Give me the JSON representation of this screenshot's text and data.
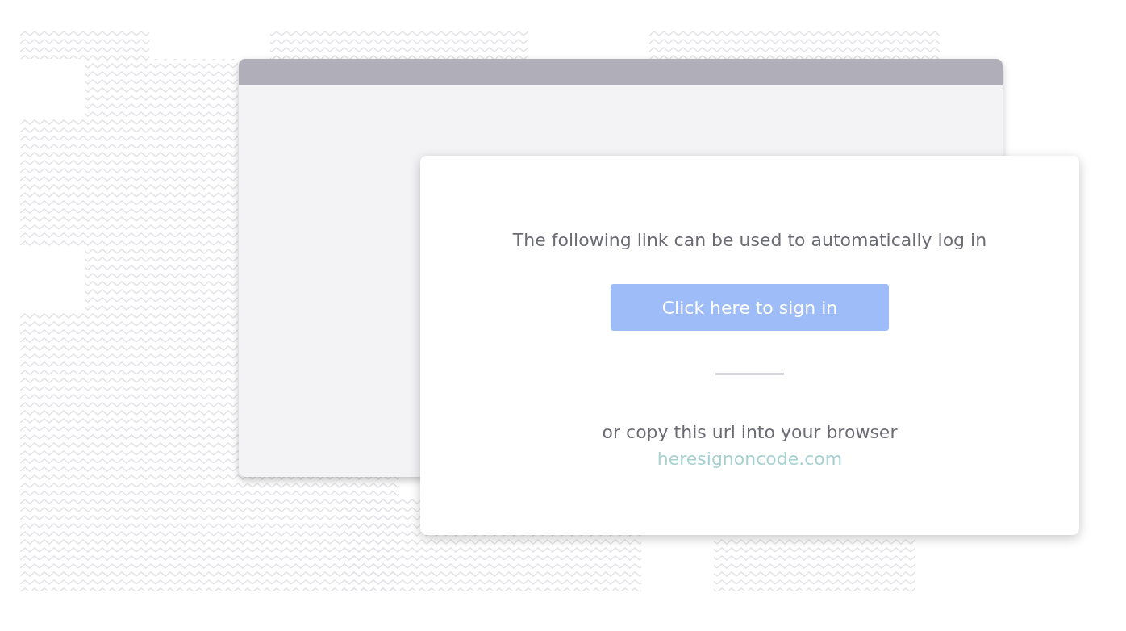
{
  "dialog": {
    "message": "The following link can be used to automatically log in",
    "button": "Click here to sign in",
    "alt_text": "or copy this url into your browser",
    "link": "heresignoncode.com"
  }
}
